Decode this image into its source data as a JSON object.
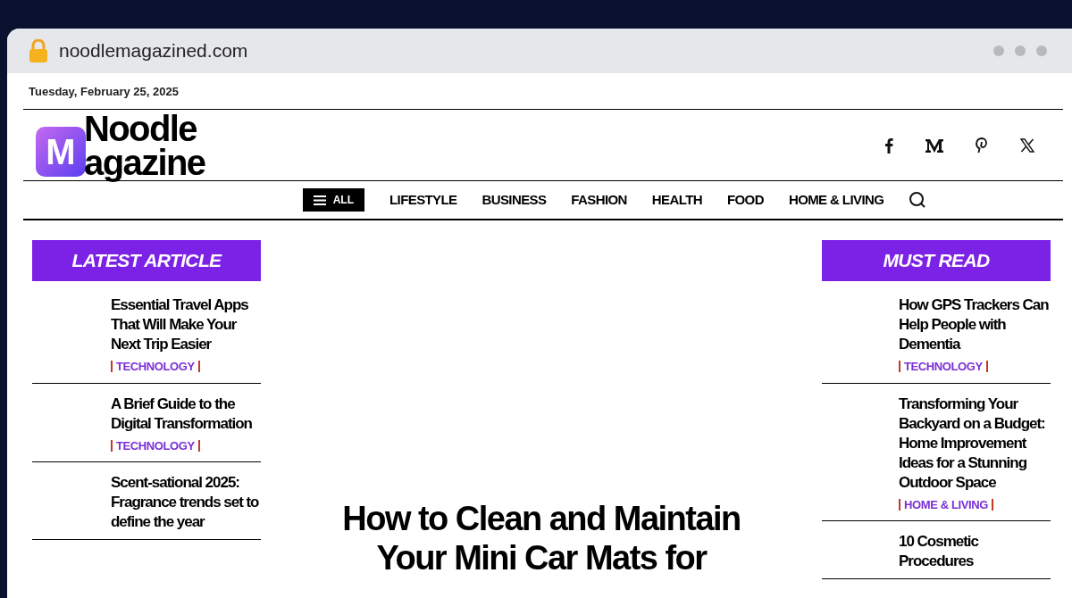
{
  "browser": {
    "url": "noodlemagazined.com"
  },
  "date": "Tuesday, February 25, 2025",
  "logo": {
    "line1": "Noodle",
    "line2": "agazine",
    "mark": "M"
  },
  "nav": {
    "menu_button": "ALL",
    "items": [
      "LIFESTYLE",
      "BUSINESS",
      "FASHION",
      "HEALTH",
      "FOOD",
      "HOME & LIVING"
    ]
  },
  "latest": {
    "heading": "LATEST ARTICLE",
    "articles": [
      {
        "title": "Essential Travel Apps That Will Make Your Next Trip Easier",
        "category": "TECHNOLOGY"
      },
      {
        "title": "A Brief Guide to the Digital Transformation",
        "category": "TECHNOLOGY"
      },
      {
        "title": "Scent-sational 2025: Fragrance trends set to define the year"
      }
    ]
  },
  "featured": {
    "title": "How to Clean and Maintain Your Mini Car Mats for"
  },
  "must_read": {
    "heading": "MUST READ",
    "articles": [
      {
        "title": "How GPS Trackers Can Help People with Dementia",
        "category": "TECHNOLOGY"
      },
      {
        "title": "Transforming Your Backyard on a Budget: Home Improvement Ideas for a Stunning Outdoor Space",
        "category": "HOME & LIVING"
      },
      {
        "title": "10 Cosmetic Procedures"
      }
    ]
  }
}
